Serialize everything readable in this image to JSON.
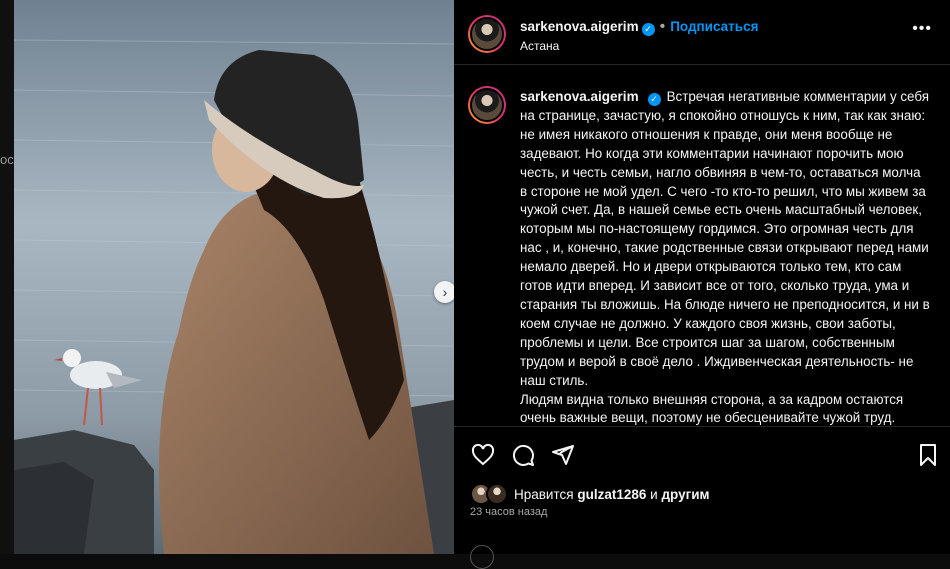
{
  "post": {
    "username": "sarkenova.aigerim",
    "follow_label": "Подписаться",
    "location": "Астана",
    "caption": "Встречая негативные комментарии у себя на странице, зачастую, я спокойно отношусь к ним, так как знаю: не имея никакого отношения к правде, они меня вообще не задевают. Но когда эти комментарии начинают порочить мою честь, и честь семьи, нагло обвиняя в чем-то, оставаться молча в стороне не мой удел. С чего -то кто-то решил, что мы живем за чужой счет. Да, в нашей семье есть очень масштабный человек, которым мы по-настоящему гордимся. Это огромная честь для нас , и, конечно, такие родственные связи открывают перед нами немало дверей. Но и двери открываются только тем, кто сам готов идти вперед. И зависит все от того, сколько труда, ума и старания ты вложишь. На блюде ничего не преподносится, и ни в коем случае не должно. У каждого своя жизнь, свои заботы, проблемы и цели. Все строится шаг за шагом, собственным трудом и верой в своё дело . Иждивенческая деятельность- не наш стиль.\nЛюдям видна только внешняя сторона, а за кадром остаются очень важные вещи, поэтому не обесценивайте чужой труд.",
    "likes_prefix": "Нравится",
    "liked_by": "gulzat1286",
    "likes_and": "и",
    "likes_others": "другим",
    "timestamp": "23 часов назад"
  },
  "left_edge_text": "ос",
  "icons": {
    "like": "heart-icon",
    "comment": "comment-icon",
    "share": "share-icon",
    "save": "bookmark-icon",
    "more": "more-icon",
    "next": "chevron-right-icon"
  },
  "colors": {
    "accent": "#0095f6",
    "background": "#000000",
    "text": "#f5f5f5",
    "muted": "#a8a8a8"
  }
}
